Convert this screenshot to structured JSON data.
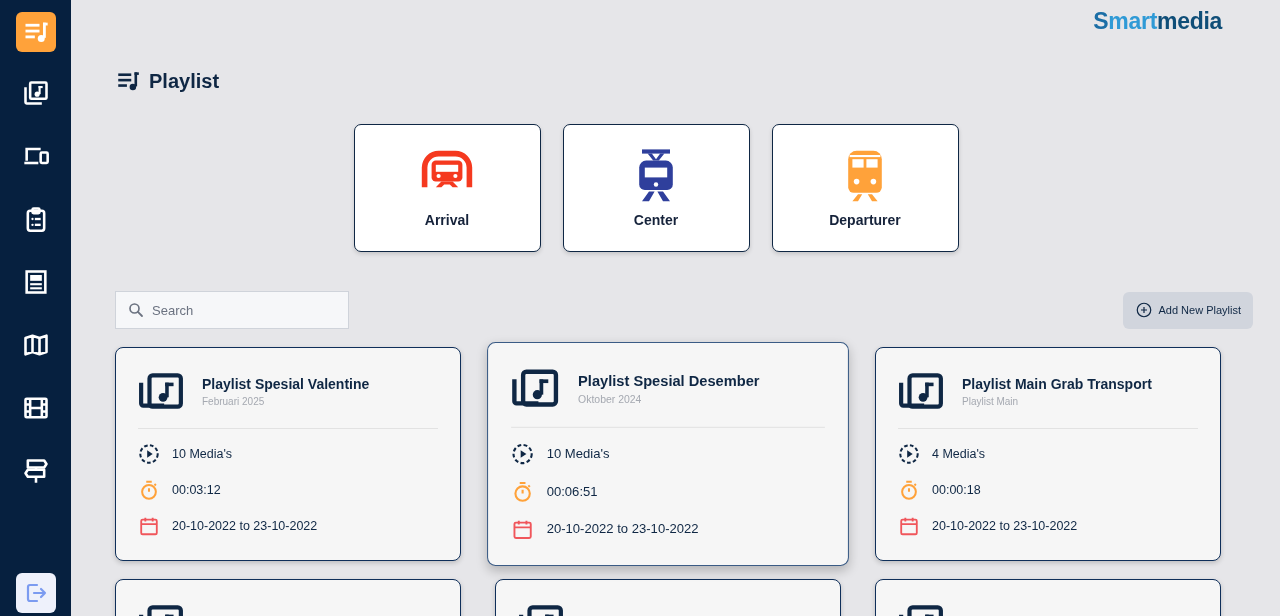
{
  "sidebar": {
    "items": [
      {
        "kind": "playlist",
        "selected": true
      },
      {
        "kind": "library",
        "selected": false
      },
      {
        "kind": "devices",
        "selected": false
      },
      {
        "kind": "clipboard",
        "selected": false
      },
      {
        "kind": "layout",
        "selected": false
      },
      {
        "kind": "map",
        "selected": false
      },
      {
        "kind": "film",
        "selected": false
      },
      {
        "kind": "signpost",
        "selected": false
      }
    ],
    "logout": {
      "kind": "logout"
    }
  },
  "logo": {
    "segments": [
      "S",
      "mart",
      "media"
    ]
  },
  "page_title": "Playlist",
  "categories": [
    {
      "label": "Arrival",
      "kind": "arrival",
      "color": "#f5391f"
    },
    {
      "label": "Center",
      "kind": "center",
      "color": "#2f3f9c"
    },
    {
      "label": "Departurer",
      "kind": "departure",
      "color": "#ffa23a"
    }
  ],
  "search": {
    "placeholder": "Search"
  },
  "add_button": "Add New Playlist",
  "playlists": [
    {
      "title": "Playlist Spesial Valentine",
      "subtitle": "Februari 2025",
      "media": "10 Media's",
      "duration": "00:03:12",
      "dates": "20-10-2022 to 23-10-2022",
      "selected": false
    },
    {
      "title": "Playlist Spesial Desember",
      "subtitle": "Oktober 2024",
      "media": "10 Media's",
      "duration": "00:06:51",
      "dates": "20-10-2022 to 23-10-2022",
      "selected": true
    },
    {
      "title": "Playlist Main Grab Transport",
      "subtitle": "Playlist Main",
      "media": "4 Media's",
      "duration": "00:00:18",
      "dates": "20-10-2022 to 23-10-2022",
      "selected": false
    },
    {
      "selected": false
    },
    {
      "selected": false
    },
    {
      "selected": false
    }
  ]
}
